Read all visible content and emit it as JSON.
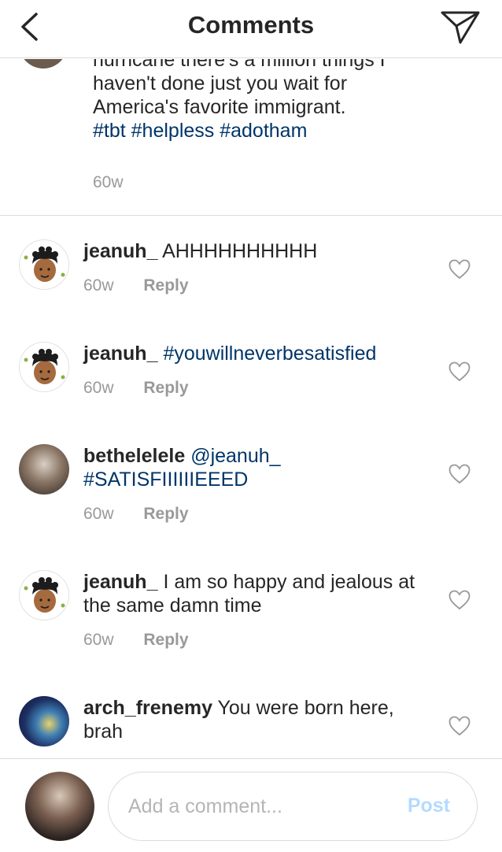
{
  "header": {
    "title": "Comments"
  },
  "caption": {
    "lines": [
      "hurricane there's a million things I",
      "haven't done just you wait for",
      "America's favorite immigrant."
    ],
    "hashtags": "#tbt #helpless #adotham",
    "time": "60w"
  },
  "comments": [
    {
      "user": "jeanuh_",
      "text": "AHHHHHHHHHH",
      "mention": "",
      "hashtag": "",
      "time": "60w",
      "reply": "Reply"
    },
    {
      "user": "jeanuh_",
      "text": "",
      "mention": "",
      "hashtag": "#youwillneverbesatisfied",
      "time": "60w",
      "reply": "Reply"
    },
    {
      "user": "bethelelele",
      "text": "",
      "mention": "@jeanuh_",
      "hashtag": "#SATISFIIIIIIEEED",
      "time": "60w",
      "reply": "Reply"
    },
    {
      "user": "jeanuh_",
      "text": "I am so happy and jealous at the same damn time",
      "mention": "",
      "hashtag": "",
      "time": "60w",
      "reply": "Reply"
    },
    {
      "user": "arch_frenemy",
      "text": "You were born here, brah",
      "mention": "",
      "hashtag": "",
      "time": "",
      "reply": ""
    }
  ],
  "footer": {
    "placeholder": "Add a comment...",
    "post_label": "Post"
  },
  "icons": {
    "back": "chevron-left-icon",
    "direct": "paper-plane-icon",
    "like": "heart-outline-icon"
  },
  "colors": {
    "link": "#003569",
    "muted": "#999999",
    "post_disabled": "#b3dbff",
    "divider": "#dbdbdb"
  }
}
